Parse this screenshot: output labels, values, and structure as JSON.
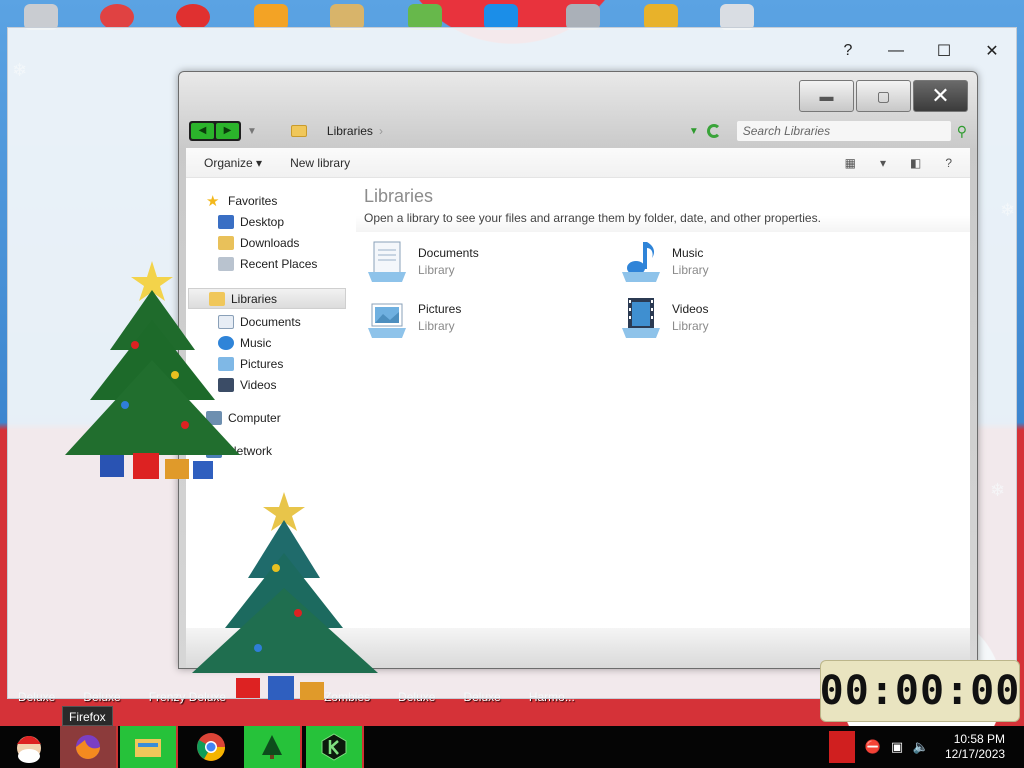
{
  "outer_window": {
    "help": "?",
    "minimize": "—",
    "maximize": "☐",
    "close": "✕"
  },
  "desktop": {
    "captions": [
      "Deluxe",
      "Deluxe",
      "Frenzy Deluxe",
      "",
      "Zombies",
      "Deluxe",
      "Deluxe",
      "Harmo..."
    ]
  },
  "explorer": {
    "address": {
      "location": "Libraries",
      "separator": "›",
      "search_placeholder": "Search Libraries"
    },
    "toolbar": {
      "organize": "Organize ▾",
      "new_library": "New library",
      "help": "?"
    },
    "nav": {
      "favorites_label": "Favorites",
      "favorites": [
        "Desktop",
        "Downloads",
        "Recent Places"
      ],
      "libraries_label": "Libraries",
      "libraries": [
        "Documents",
        "Music",
        "Pictures",
        "Videos"
      ],
      "computer": "Computer",
      "network": "Network"
    },
    "main": {
      "title": "Libraries",
      "description": "Open a library to see your files and arrange them by folder, date, and other properties.",
      "items": [
        {
          "name": "Documents",
          "type": "Library"
        },
        {
          "name": "Music",
          "type": "Library"
        },
        {
          "name": "Pictures",
          "type": "Library"
        },
        {
          "name": "Videos",
          "type": "Library"
        }
      ]
    }
  },
  "timer": {
    "display": "00:00:00"
  },
  "taskbar": {
    "tooltip": "Firefox",
    "time": "10:58 PM",
    "date": "12/17/2023"
  },
  "colors": {
    "nav_arrows": "#2bb32b",
    "taskbar_bg": "#050505",
    "taskbar_active": "#26c23a"
  }
}
